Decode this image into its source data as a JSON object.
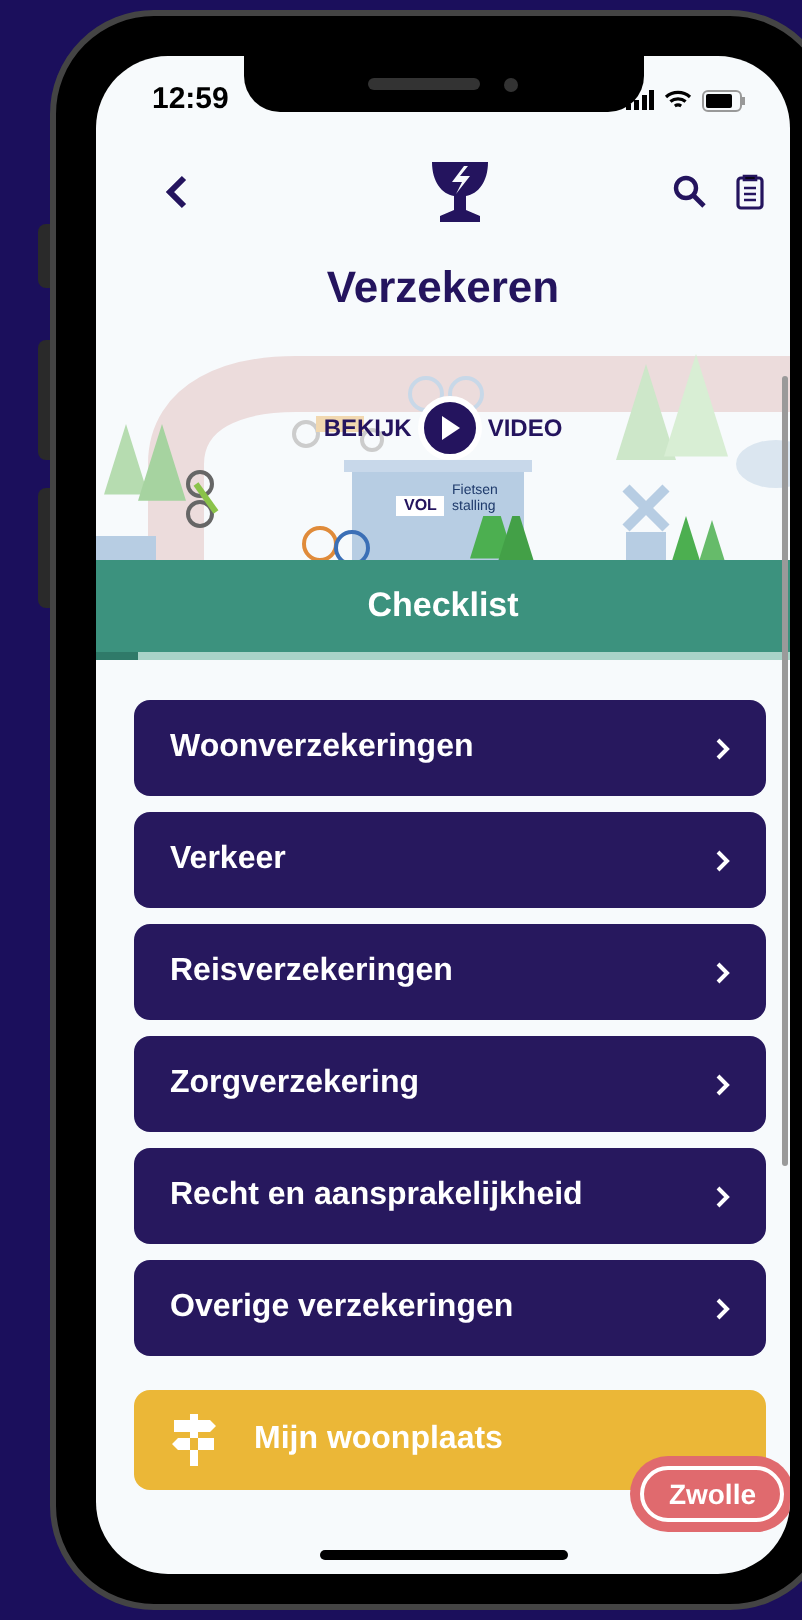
{
  "status_bar": {
    "time": "12:59"
  },
  "header": {
    "title": "Verzekeren"
  },
  "banner": {
    "label_left": "BEKIJK",
    "label_right": "VIDEO",
    "sign": "VOL",
    "building_label": "Fietsen stalling"
  },
  "section": {
    "title": "Checklist",
    "level": 0.06
  },
  "menu": [
    {
      "label": "Woonverzekeringen"
    },
    {
      "label": "Verkeer"
    },
    {
      "label": "Reisverzekeringen"
    },
    {
      "label": "Zorgverzekering"
    },
    {
      "label": "Recht en aansprakelijkheid"
    },
    {
      "label": "Overige verzekeringen"
    }
  ],
  "location_button": {
    "label": "Mijn woonplaats"
  },
  "location_badge": {
    "label": "Zwolle"
  }
}
